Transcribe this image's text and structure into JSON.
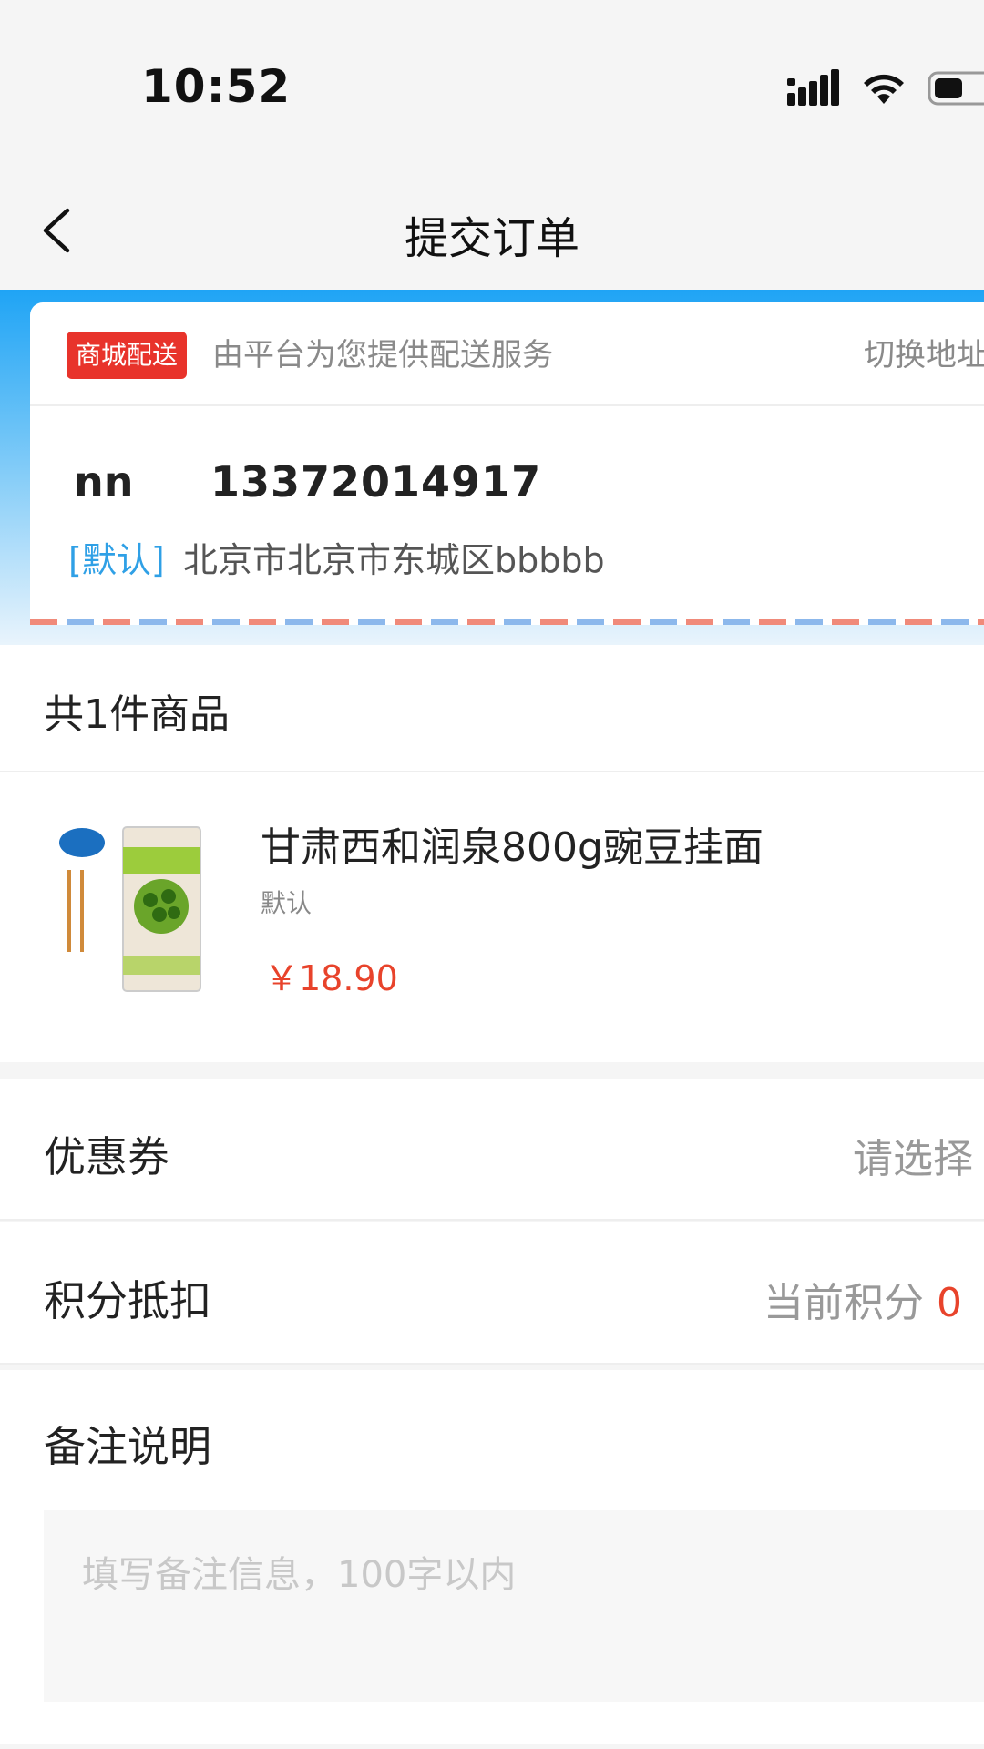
{
  "status_bar": {
    "time": "10:52",
    "icons": [
      "signal-icon",
      "wifi-icon",
      "battery-icon"
    ]
  },
  "nav": {
    "title": "提交订单",
    "back_icon": "back-icon"
  },
  "colors": {
    "accent_blue": "#1fa4f5",
    "badge_red": "#e8332b",
    "price_red": "#e8432b",
    "default_tag_blue": "#2fa0e6"
  },
  "address": {
    "delivery_badge": "商城配送",
    "delivery_desc": "由平台为您提供配送服务",
    "switch_label": "切换地址",
    "name": "nn",
    "phone": "13372014917",
    "default_tag": "[默认]",
    "full_address": "北京市北京市东城区bbbbb"
  },
  "goods": {
    "count_label": "共1件商品",
    "items": [
      {
        "name": "甘肃西和润泉800g豌豆挂面",
        "spec": "默认",
        "price": "￥18.90"
      }
    ]
  },
  "coupon": {
    "label": "优惠券",
    "value": "请选择"
  },
  "points": {
    "label": "积分抵扣",
    "value_label": "当前积分",
    "value": "0"
  },
  "remark": {
    "title": "备注说明",
    "placeholder": "填写备注信息，100字以内",
    "value": ""
  }
}
